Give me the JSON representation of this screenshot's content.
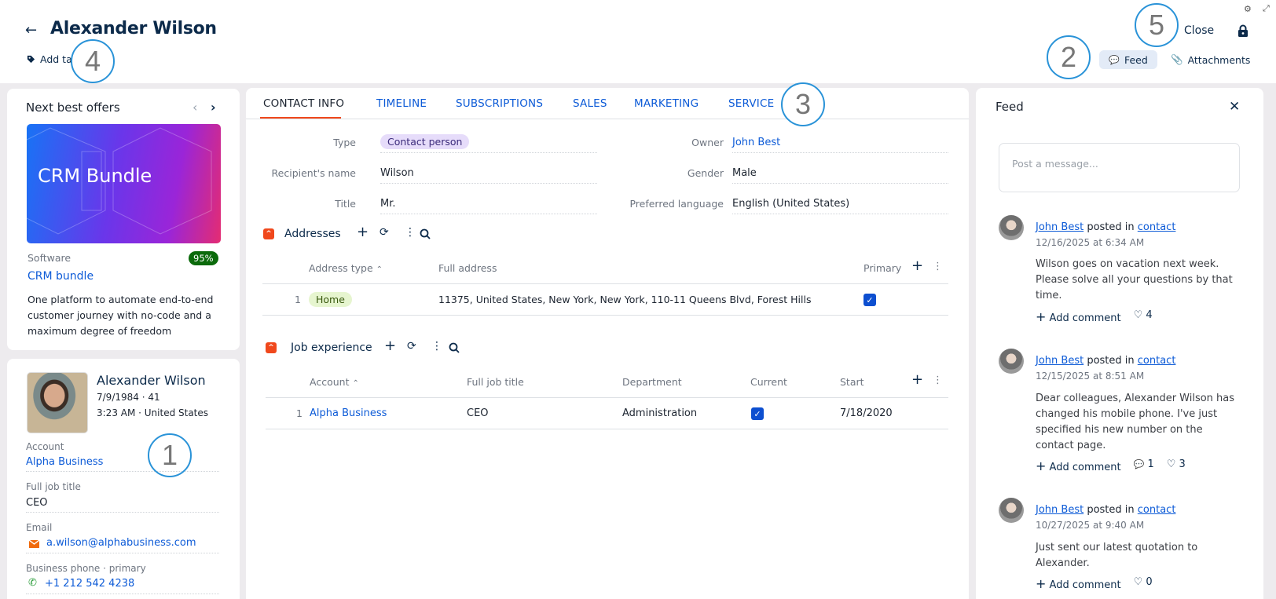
{
  "header": {
    "title": "Alexander Wilson",
    "add_tag": "Add tag",
    "close": "Close",
    "feed_button": "Feed",
    "attachments_button": "Attachments"
  },
  "annotations": [
    "1",
    "2",
    "3",
    "4",
    "5"
  ],
  "offers": {
    "title": "Next best offers",
    "banner_text": "CRM Bundle",
    "category": "Software",
    "score": "95%",
    "name": "CRM bundle",
    "description": "One platform to automate end-to-end customer journey with no-code and a maximum degree of freedom"
  },
  "profile": {
    "name": "Alexander Wilson",
    "birth": "7/9/1984 · 41",
    "local": "3:23 AM · United States",
    "fields": [
      {
        "label": "Account",
        "value": "Alpha Business"
      },
      {
        "label": "Full job title",
        "value": "CEO"
      },
      {
        "label": "Email",
        "value": "a.wilson@alphabusiness.com"
      },
      {
        "label": "Business phone · primary",
        "value": "+1 212 542 4238"
      }
    ]
  },
  "tabs": [
    "CONTACT INFO",
    "TIMELINE",
    "SUBSCRIPTIONS",
    "SALES",
    "MARKETING",
    "SERVICE"
  ],
  "contact": {
    "left": [
      {
        "label": "Type",
        "value": "Contact person"
      },
      {
        "label": "Recipient's name",
        "value": "Wilson"
      },
      {
        "label": "Title",
        "value": "Mr."
      }
    ],
    "right": [
      {
        "label": "Owner",
        "value": "John Best"
      },
      {
        "label": "Gender",
        "value": "Male"
      },
      {
        "label": "Preferred language",
        "value": "English (United States)"
      }
    ]
  },
  "addresses": {
    "title": "Addresses",
    "columns": [
      "Address type",
      "Full address",
      "Primary"
    ],
    "rows": [
      {
        "num": "1",
        "type": "Home",
        "address": "11375, United States, New York, New York, 110-11 Queens Blvd, Forest Hills",
        "primary": true
      }
    ]
  },
  "jobs": {
    "title": "Job experience",
    "columns": [
      "Account",
      "Full job title",
      "Department",
      "Current",
      "Start"
    ],
    "rows": [
      {
        "num": "1",
        "account": "Alpha Business",
        "title": "CEO",
        "department": "Administration",
        "current": true,
        "start": "7/18/2020"
      }
    ]
  },
  "feed": {
    "title": "Feed",
    "placeholder": "Post a message...",
    "posted_in": "posted in",
    "add_comment": "Add comment",
    "posts": [
      {
        "author": "John Best",
        "target": "contact",
        "date": "12/16/2025 at 6:34 AM",
        "text": "Wilson goes on vacation next week. Please solve all your questions by that time.",
        "likes": "4"
      },
      {
        "author": "John Best",
        "target": "contact",
        "date": "12/15/2025 at 8:51 AM",
        "text": "Dear colleagues, Alexander Wilson has changed his mobile phone. I've just specified his new number on the contact page.",
        "comments": "1",
        "likes": "3"
      },
      {
        "author": "John Best",
        "target": "contact",
        "date": "10/27/2025 at 9:40 AM",
        "text": "Just sent our latest quotation to Alexander.",
        "likes": "0"
      }
    ]
  },
  "colors": {
    "accent": "#f0481c",
    "link": "#0d5bd7",
    "navy": "#0c2a4a",
    "badge_green": "#0b6a0b"
  }
}
